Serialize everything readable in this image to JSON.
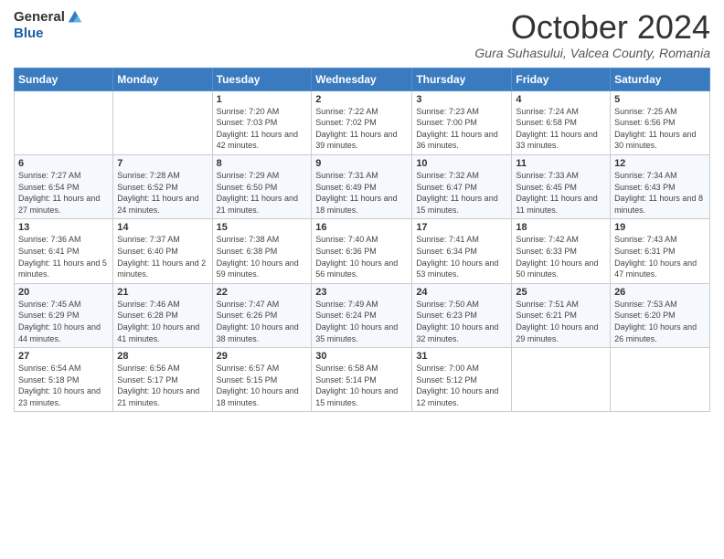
{
  "logo": {
    "general": "General",
    "blue": "Blue"
  },
  "header": {
    "month_title": "October 2024",
    "location": "Gura Suhasului, Valcea County, Romania"
  },
  "days_of_week": [
    "Sunday",
    "Monday",
    "Tuesday",
    "Wednesday",
    "Thursday",
    "Friday",
    "Saturday"
  ],
  "weeks": [
    [
      {
        "day": "",
        "sunrise": "",
        "sunset": "",
        "daylight": ""
      },
      {
        "day": "",
        "sunrise": "",
        "sunset": "",
        "daylight": ""
      },
      {
        "day": "1",
        "sunrise": "Sunrise: 7:20 AM",
        "sunset": "Sunset: 7:03 PM",
        "daylight": "Daylight: 11 hours and 42 minutes."
      },
      {
        "day": "2",
        "sunrise": "Sunrise: 7:22 AM",
        "sunset": "Sunset: 7:02 PM",
        "daylight": "Daylight: 11 hours and 39 minutes."
      },
      {
        "day": "3",
        "sunrise": "Sunrise: 7:23 AM",
        "sunset": "Sunset: 7:00 PM",
        "daylight": "Daylight: 11 hours and 36 minutes."
      },
      {
        "day": "4",
        "sunrise": "Sunrise: 7:24 AM",
        "sunset": "Sunset: 6:58 PM",
        "daylight": "Daylight: 11 hours and 33 minutes."
      },
      {
        "day": "5",
        "sunrise": "Sunrise: 7:25 AM",
        "sunset": "Sunset: 6:56 PM",
        "daylight": "Daylight: 11 hours and 30 minutes."
      }
    ],
    [
      {
        "day": "6",
        "sunrise": "Sunrise: 7:27 AM",
        "sunset": "Sunset: 6:54 PM",
        "daylight": "Daylight: 11 hours and 27 minutes."
      },
      {
        "day": "7",
        "sunrise": "Sunrise: 7:28 AM",
        "sunset": "Sunset: 6:52 PM",
        "daylight": "Daylight: 11 hours and 24 minutes."
      },
      {
        "day": "8",
        "sunrise": "Sunrise: 7:29 AM",
        "sunset": "Sunset: 6:50 PM",
        "daylight": "Daylight: 11 hours and 21 minutes."
      },
      {
        "day": "9",
        "sunrise": "Sunrise: 7:31 AM",
        "sunset": "Sunset: 6:49 PM",
        "daylight": "Daylight: 11 hours and 18 minutes."
      },
      {
        "day": "10",
        "sunrise": "Sunrise: 7:32 AM",
        "sunset": "Sunset: 6:47 PM",
        "daylight": "Daylight: 11 hours and 15 minutes."
      },
      {
        "day": "11",
        "sunrise": "Sunrise: 7:33 AM",
        "sunset": "Sunset: 6:45 PM",
        "daylight": "Daylight: 11 hours and 11 minutes."
      },
      {
        "day": "12",
        "sunrise": "Sunrise: 7:34 AM",
        "sunset": "Sunset: 6:43 PM",
        "daylight": "Daylight: 11 hours and 8 minutes."
      }
    ],
    [
      {
        "day": "13",
        "sunrise": "Sunrise: 7:36 AM",
        "sunset": "Sunset: 6:41 PM",
        "daylight": "Daylight: 11 hours and 5 minutes."
      },
      {
        "day": "14",
        "sunrise": "Sunrise: 7:37 AM",
        "sunset": "Sunset: 6:40 PM",
        "daylight": "Daylight: 11 hours and 2 minutes."
      },
      {
        "day": "15",
        "sunrise": "Sunrise: 7:38 AM",
        "sunset": "Sunset: 6:38 PM",
        "daylight": "Daylight: 10 hours and 59 minutes."
      },
      {
        "day": "16",
        "sunrise": "Sunrise: 7:40 AM",
        "sunset": "Sunset: 6:36 PM",
        "daylight": "Daylight: 10 hours and 56 minutes."
      },
      {
        "day": "17",
        "sunrise": "Sunrise: 7:41 AM",
        "sunset": "Sunset: 6:34 PM",
        "daylight": "Daylight: 10 hours and 53 minutes."
      },
      {
        "day": "18",
        "sunrise": "Sunrise: 7:42 AM",
        "sunset": "Sunset: 6:33 PM",
        "daylight": "Daylight: 10 hours and 50 minutes."
      },
      {
        "day": "19",
        "sunrise": "Sunrise: 7:43 AM",
        "sunset": "Sunset: 6:31 PM",
        "daylight": "Daylight: 10 hours and 47 minutes."
      }
    ],
    [
      {
        "day": "20",
        "sunrise": "Sunrise: 7:45 AM",
        "sunset": "Sunset: 6:29 PM",
        "daylight": "Daylight: 10 hours and 44 minutes."
      },
      {
        "day": "21",
        "sunrise": "Sunrise: 7:46 AM",
        "sunset": "Sunset: 6:28 PM",
        "daylight": "Daylight: 10 hours and 41 minutes."
      },
      {
        "day": "22",
        "sunrise": "Sunrise: 7:47 AM",
        "sunset": "Sunset: 6:26 PM",
        "daylight": "Daylight: 10 hours and 38 minutes."
      },
      {
        "day": "23",
        "sunrise": "Sunrise: 7:49 AM",
        "sunset": "Sunset: 6:24 PM",
        "daylight": "Daylight: 10 hours and 35 minutes."
      },
      {
        "day": "24",
        "sunrise": "Sunrise: 7:50 AM",
        "sunset": "Sunset: 6:23 PM",
        "daylight": "Daylight: 10 hours and 32 minutes."
      },
      {
        "day": "25",
        "sunrise": "Sunrise: 7:51 AM",
        "sunset": "Sunset: 6:21 PM",
        "daylight": "Daylight: 10 hours and 29 minutes."
      },
      {
        "day": "26",
        "sunrise": "Sunrise: 7:53 AM",
        "sunset": "Sunset: 6:20 PM",
        "daylight": "Daylight: 10 hours and 26 minutes."
      }
    ],
    [
      {
        "day": "27",
        "sunrise": "Sunrise: 6:54 AM",
        "sunset": "Sunset: 5:18 PM",
        "daylight": "Daylight: 10 hours and 23 minutes."
      },
      {
        "day": "28",
        "sunrise": "Sunrise: 6:56 AM",
        "sunset": "Sunset: 5:17 PM",
        "daylight": "Daylight: 10 hours and 21 minutes."
      },
      {
        "day": "29",
        "sunrise": "Sunrise: 6:57 AM",
        "sunset": "Sunset: 5:15 PM",
        "daylight": "Daylight: 10 hours and 18 minutes."
      },
      {
        "day": "30",
        "sunrise": "Sunrise: 6:58 AM",
        "sunset": "Sunset: 5:14 PM",
        "daylight": "Daylight: 10 hours and 15 minutes."
      },
      {
        "day": "31",
        "sunrise": "Sunrise: 7:00 AM",
        "sunset": "Sunset: 5:12 PM",
        "daylight": "Daylight: 10 hours and 12 minutes."
      },
      {
        "day": "",
        "sunrise": "",
        "sunset": "",
        "daylight": ""
      },
      {
        "day": "",
        "sunrise": "",
        "sunset": "",
        "daylight": ""
      }
    ]
  ]
}
